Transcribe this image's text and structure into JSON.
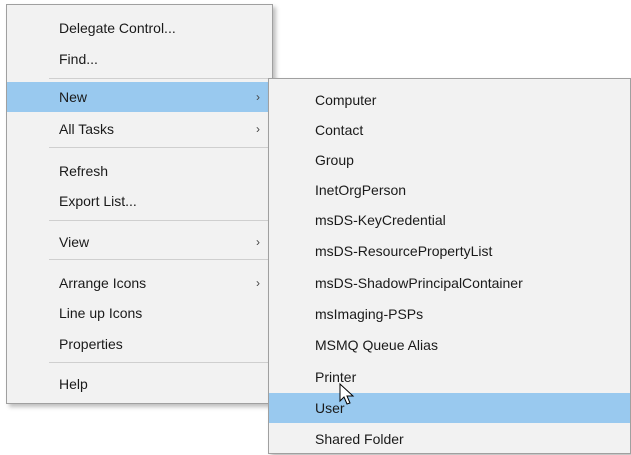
{
  "main_menu": {
    "items": [
      {
        "label": "Delegate Control..."
      },
      {
        "label": "Find..."
      },
      {
        "label": "New",
        "chevron": "›"
      },
      {
        "label": "All Tasks",
        "chevron": "›"
      },
      {
        "label": "Refresh"
      },
      {
        "label": "Export List..."
      },
      {
        "label": "View",
        "chevron": "›"
      },
      {
        "label": "Arrange Icons",
        "chevron": "›"
      },
      {
        "label": "Line up Icons"
      },
      {
        "label": "Properties"
      },
      {
        "label": "Help"
      }
    ]
  },
  "sub_menu": {
    "items": [
      {
        "label": "Computer"
      },
      {
        "label": "Contact"
      },
      {
        "label": "Group"
      },
      {
        "label": "InetOrgPerson"
      },
      {
        "label": "msDS-KeyCredential"
      },
      {
        "label": "msDS-ResourcePropertyList"
      },
      {
        "label": "msDS-ShadowPrincipalContainer"
      },
      {
        "label": "msImaging-PSPs"
      },
      {
        "label": "MSMQ Queue Alias"
      },
      {
        "label": "Printer"
      },
      {
        "label": "User"
      },
      {
        "label": "Shared Folder"
      }
    ]
  },
  "colors": {
    "highlight": "#99c9ef",
    "menu_bg": "#f2f2f2"
  },
  "icons": {
    "cursor": "mouse-pointer-icon"
  }
}
